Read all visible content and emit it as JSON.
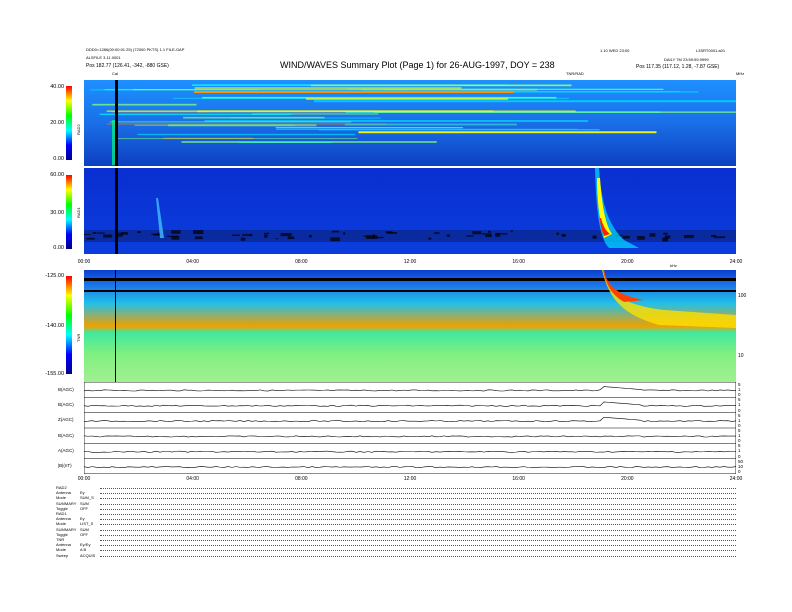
{
  "header": {
    "left_line1": "DDD0=1286(00:00:01.25) (72000 PKTS) 1.1 FILE-GAP",
    "left_line2": "ALSFILE 3.11.0001",
    "left_line3": "Pos 182.77 (126.41, -342, -880 GSE)",
    "title": "WIND/WAVES Summary Plot (Page 1) for 26-AUG-1997, DOY = 238",
    "right_line1": "1.10 WED 23:00",
    "right_line1b": "L3SRT0001.a01",
    "right_line2": "DAILY 7M 23:59:59.9999",
    "right_line3": "Pos 117.35 (117.12, 1.28, -7.87 GSE)",
    "cal_label": "Cal",
    "mhz_label": "MHz",
    "rad1_tag": "TNR/RAD",
    "khz_label": "kHz"
  },
  "panels": {
    "rad2": {
      "label": "RAD2",
      "ticks": [
        "40.00",
        "20.00",
        "0.00"
      ]
    },
    "rad1": {
      "label": "RAD1",
      "ticks": [
        "60.00",
        "30.00",
        "0.00"
      ]
    },
    "tnr": {
      "label": "TNR",
      "ticks": [
        "-125.00",
        "-140.00",
        "-155.00"
      ],
      "right_ticks": [
        "100",
        "10"
      ]
    },
    "time_ticks": [
      "00:00",
      "04:00",
      "08:00",
      "12:00",
      "16:00",
      "20:00",
      "24:00"
    ],
    "lines": [
      {
        "label": "B(AGC)",
        "right": [
          "5",
          "1",
          "0"
        ]
      },
      {
        "label": "B(AGC)",
        "right": [
          "5",
          "1",
          "0"
        ]
      },
      {
        "label": "Z(AGC)",
        "right": [
          "5",
          "1",
          "0"
        ]
      },
      {
        "label": "B(AGC)",
        "right": [
          "5",
          "1",
          "0"
        ]
      },
      {
        "label": "A(AGC)",
        "right": [
          "5",
          "1",
          "0"
        ]
      },
      {
        "label": "|B|(nT)",
        "right": [
          "50",
          "10",
          "0"
        ]
      }
    ],
    "bottom_ticks": [
      "00:00",
      "04:00",
      "08:00",
      "12:00",
      "16:00",
      "20:00",
      "24:00"
    ]
  },
  "footer": [
    {
      "k": "RAD2",
      "v": ""
    },
    {
      "k": "Antenna",
      "v": "Ey"
    },
    {
      "k": "Mode",
      "v": "SUM_S"
    },
    {
      "k": "SUMMARY",
      "v": "SUM"
    },
    {
      "k": "Toggle",
      "v": "OFF"
    },
    {
      "k": "RAD1",
      "v": ""
    },
    {
      "k": "Antenna",
      "v": "Ey"
    },
    {
      "k": "Mode",
      "v": "LIST_S"
    },
    {
      "k": "SUMMARY",
      "v": "SUM"
    },
    {
      "k": "Toggle",
      "v": "OFF"
    },
    {
      "k": "TNR",
      "v": ""
    },
    {
      "k": "Antenna",
      "v": "Ey/Ey"
    },
    {
      "k": "Mode",
      "v": "A B"
    },
    {
      "k": "Sweep",
      "v": "ACQUIS"
    }
  ],
  "chart_data": {
    "type": "heatmap",
    "title": "WIND/WAVES Summary Plot (Page 1) for 26-AUG-1997, DOY = 238",
    "x": {
      "label": "",
      "unit": "hours",
      "range": [
        0,
        24
      ],
      "ticks": [
        "00:00",
        "04:00",
        "08:00",
        "12:00",
        "16:00",
        "20:00",
        "24:00"
      ]
    },
    "series": [
      {
        "name": "RAD2",
        "yrange": [
          0,
          40
        ],
        "ticks": [
          0,
          20,
          40
        ],
        "colorscale": "jet"
      },
      {
        "name": "RAD1",
        "yrange": [
          0,
          60
        ],
        "ticks": [
          0,
          30,
          60
        ],
        "colorscale": "jet"
      },
      {
        "name": "TNR",
        "yrange": [
          -155,
          -125
        ],
        "ticks": [
          -155,
          -140,
          -125
        ],
        "colorscale": "jet"
      }
    ],
    "features": [
      {
        "panel": "RAD1",
        "type": "type III burst",
        "start_hour": 18.9,
        "peak_hour": 19.2,
        "end_hour": 21.0
      },
      {
        "panel": "TNR",
        "type": "type III burst",
        "start_hour": 19.0,
        "end_hour": 24.0
      },
      {
        "panel": "RAD1",
        "type": "burst",
        "start_hour": 2.8,
        "end_hour": 3.1
      }
    ],
    "colors": {
      "low": "#00008b",
      "mid": "#00ffff",
      "high": "#ff0000",
      "peak": "#ffff00"
    }
  }
}
